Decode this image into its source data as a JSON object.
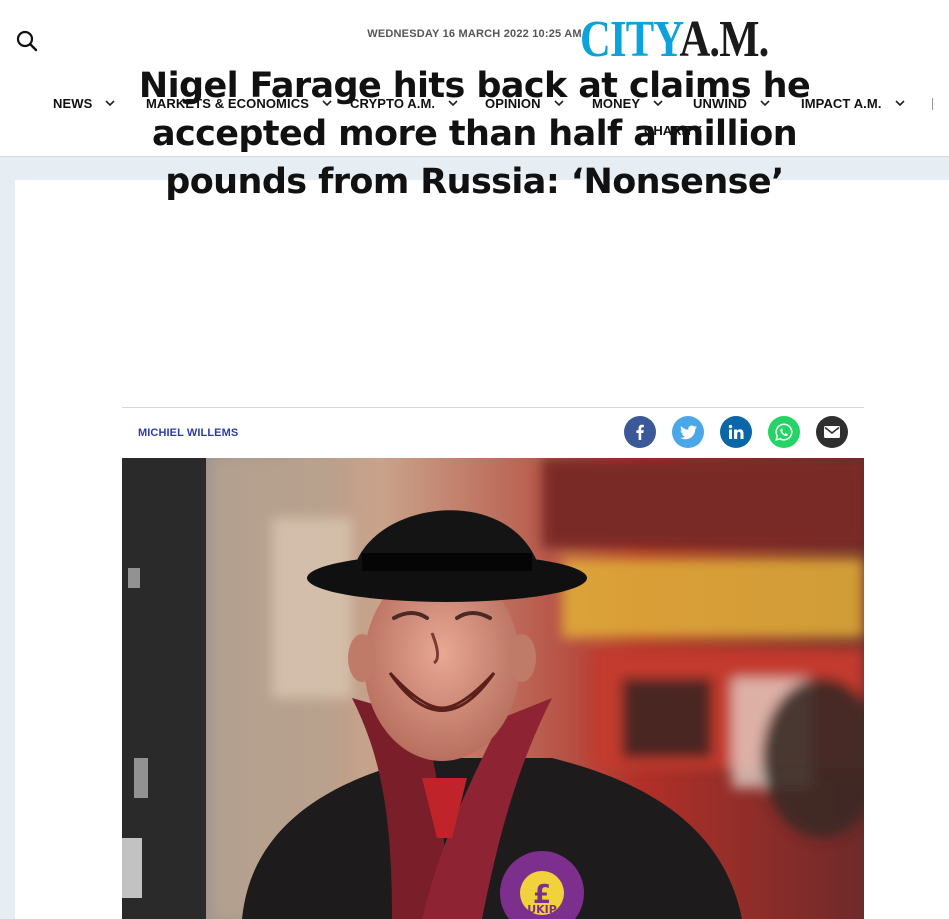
{
  "header": {
    "logo": {
      "city": "CITY",
      "am": "A.M."
    },
    "nav": [
      {
        "label": "NEWS"
      },
      {
        "label": "MARKETS & ECONOMICS"
      },
      {
        "label": "CRYPTO A.M."
      },
      {
        "label": "OPINION"
      },
      {
        "label": "MONEY"
      },
      {
        "label": "UNWIND"
      },
      {
        "label": "IMPACT A.M."
      }
    ],
    "nav_extra": "CHARITY"
  },
  "article": {
    "date": "WEDNESDAY 16 MARCH 2022 10:25 AM",
    "headline_lines": [
      "Nigel Farage hits back at claims he",
      "accepted more than half a million",
      "pounds from Russia: ‘Nonsense’"
    ],
    "author": "MICHIEL WILLEMS",
    "image": {
      "rosette_text": "UKIP",
      "rosette_symbol": "£"
    }
  },
  "share": {
    "buttons": [
      "facebook-icon",
      "twitter-icon",
      "linkedin-icon",
      "whatsapp-icon",
      "email-icon"
    ],
    "colors": {
      "facebook": "#3b5998",
      "twitter": "#4aa8e8",
      "linkedin": "#0a66a8",
      "whatsapp": "#25d366",
      "email": "#2f2f2f"
    }
  },
  "colors": {
    "brand": "#0ca3dc",
    "author_link": "#2b3fa8"
  }
}
